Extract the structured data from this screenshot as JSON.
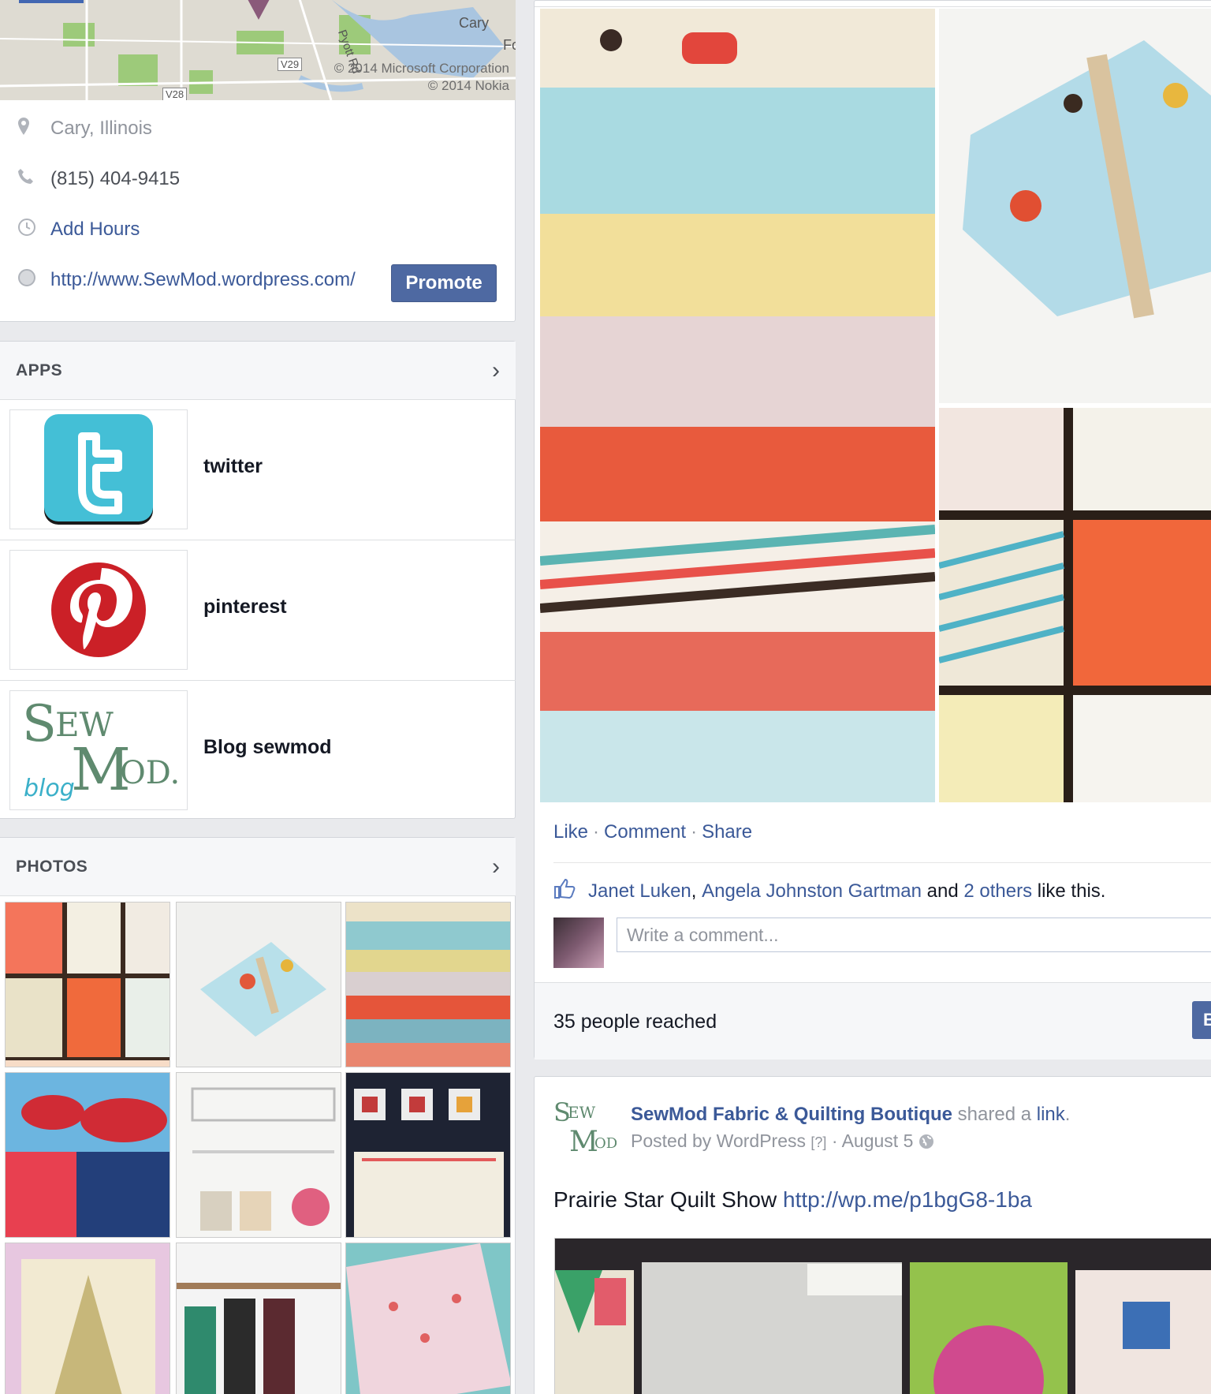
{
  "about": {
    "map_place_top": "Cary",
    "map_place_fox": "Fo",
    "map_road": "Pyott Rd",
    "map_route1": "V29",
    "map_route2": "V28",
    "map_attr1": "© 2014 Microsoft Corporation",
    "map_attr2": "© 2014 Nokia",
    "location": "Cary, Illinois",
    "phone": "(815) 404-9415",
    "hours_link": "Add Hours",
    "website": "http://www.SewMod.wordpress.com/",
    "promote_label": "Promote"
  },
  "apps": {
    "title": "APPS",
    "items": [
      {
        "label": "twitter",
        "icon": "twitter-icon"
      },
      {
        "label": "pinterest",
        "icon": "pinterest-icon"
      },
      {
        "label": "Blog sewmod",
        "icon": "sewmod-blog-logo"
      }
    ]
  },
  "photos": {
    "title": "PHOTOS"
  },
  "post1": {
    "like": "Like",
    "comment": "Comment",
    "share": "Share",
    "liker1": "Janet Luken",
    "liker2": "Angela Johnston Gartman",
    "and_text": "and",
    "others": "2 others",
    "like_this": "like this.",
    "comment_placeholder": "Write a comment...",
    "reach": "35 people reached",
    "boost_label": "B"
  },
  "post2": {
    "page_name": "SewMod Fabric & Quilting Boutique",
    "shared_a": "shared a",
    "link_word": "link",
    "posted_by": "Posted by WordPress",
    "help": "[?]",
    "date": "August 5",
    "text": "Prairie Star Quilt Show",
    "url": "http://wp.me/p1bgG8-1ba"
  },
  "colors": {
    "link": "#3b5998",
    "button": "#4e69a2",
    "background": "#e9eaed"
  }
}
